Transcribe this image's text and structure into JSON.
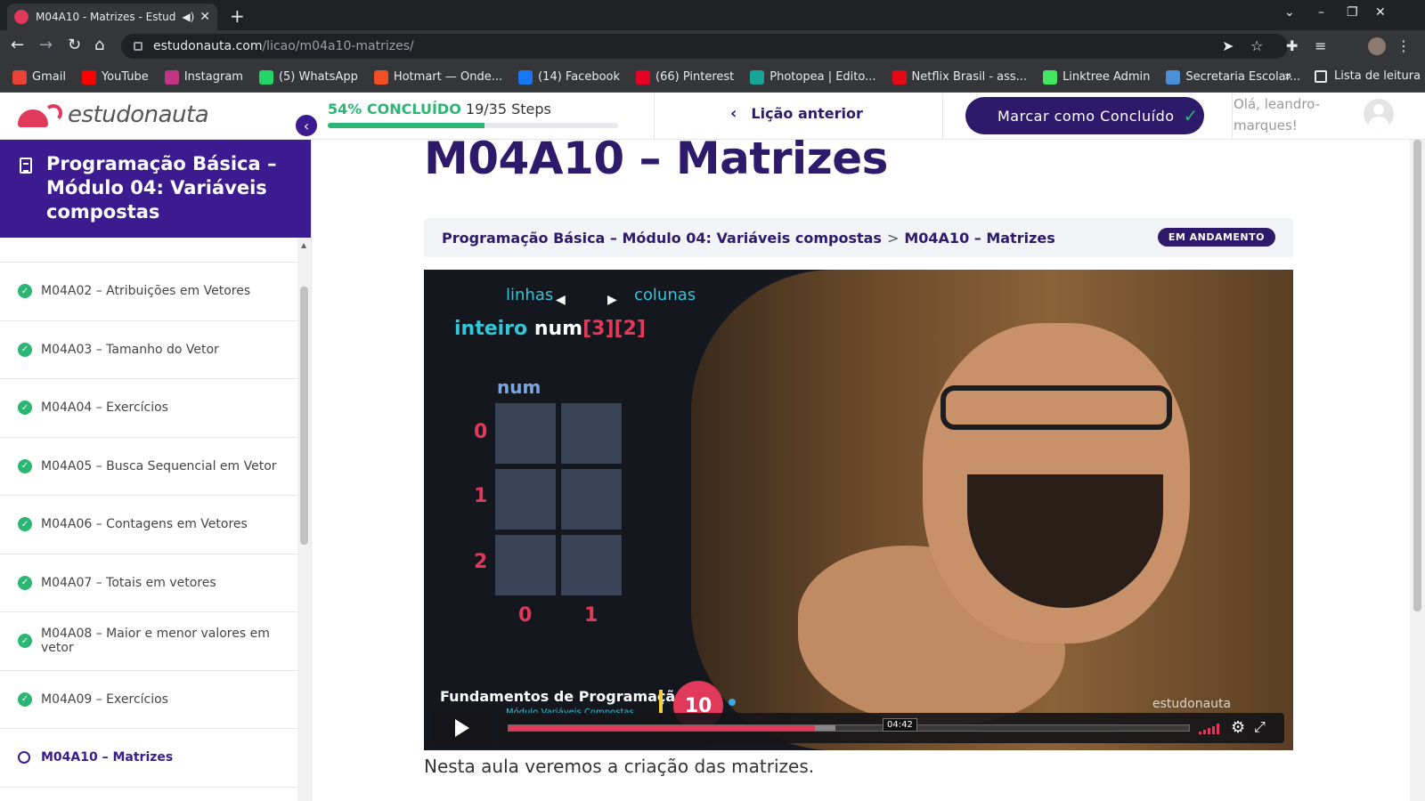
{
  "browser": {
    "tab_title": "M04A10 - Matrizes - Estud",
    "url_host": "estudonauta.com",
    "url_path": "/licao/m04a10-matrizes/",
    "bookmarks": [
      {
        "label": "Gmail",
        "color": "#ea4335",
        "icon": "gmail-icon"
      },
      {
        "label": "YouTube",
        "color": "#ff0000",
        "icon": "youtube-icon"
      },
      {
        "label": "Instagram",
        "color": "#c13584",
        "icon": "instagram-icon"
      },
      {
        "label": "(5) WhatsApp",
        "color": "#25d366",
        "icon": "whatsapp-icon"
      },
      {
        "label": "Hotmart — Onde...",
        "color": "#f04e23",
        "icon": "hotmart-icon"
      },
      {
        "label": "(14) Facebook",
        "color": "#1877f2",
        "icon": "facebook-icon"
      },
      {
        "label": "(66) Pinterest",
        "color": "#e60023",
        "icon": "pinterest-icon"
      },
      {
        "label": "Photopea | Edito...",
        "color": "#18a497",
        "icon": "photopea-icon"
      },
      {
        "label": "Netflix Brasil - ass...",
        "color": "#e50914",
        "icon": "netflix-icon"
      },
      {
        "label": "Linktree Admin",
        "color": "#43e660",
        "icon": "linktree-icon"
      },
      {
        "label": "Secretaria Escolar...",
        "color": "#4a90d9",
        "icon": "secretaria-icon"
      }
    ],
    "more_bookmarks": "»",
    "reading_list": "Lista de leitura"
  },
  "header": {
    "logo_text": "estudonauta",
    "progress_pct_label": "54% CONCLUÍDO",
    "progress_steps": "19/35 Steps",
    "progress_fraction": 0.54,
    "prev_lesson": "Lição anterior",
    "mark_complete": "Marcar como Concluído",
    "greeting": "Olá, leandro-marques!"
  },
  "sidebar": {
    "course_title": "Programação Básica – Módulo 04: Variáveis compostas",
    "lessons": [
      {
        "label": "M04A02 – Atribuições em Vetores",
        "done": true
      },
      {
        "label": "M04A03 – Tamanho do Vetor",
        "done": true
      },
      {
        "label": "M04A04 – Exercícios",
        "done": true
      },
      {
        "label": "M04A05 – Busca Sequencial em Vetor",
        "done": true
      },
      {
        "label": "M04A06 – Contagens em Vetores",
        "done": true
      },
      {
        "label": "M04A07 – Totais em vetores",
        "done": true
      },
      {
        "label": "M04A08 – Maior e menor valores em vetor",
        "done": true
      },
      {
        "label": "M04A09 – Exercícios",
        "done": true
      },
      {
        "label": "M04A10 – Matrizes",
        "done": false
      }
    ]
  },
  "main": {
    "title": "M04A10 – Matrizes",
    "breadcrumb": {
      "course": "Programação Básica – Módulo 04: Variáveis compostas",
      "separator": ">",
      "lesson": "M04A10 – Matrizes"
    },
    "status_badge": "EM ANDAMENTO",
    "description": "Nesta aula veremos a criação das matrizes."
  },
  "video": {
    "label_rows": "linhas",
    "label_cols": "colunas",
    "code_kw": "inteiro",
    "code_var": "num",
    "code_idx": "[3][2]",
    "grid_label": "num",
    "row_labels": [
      "0",
      "1",
      "2"
    ],
    "col_labels": [
      "0",
      "1"
    ],
    "footer_title": "Fundamentos de Programação",
    "footer_sub": "Módulo Variáveis Compostas",
    "episode": "10",
    "watermark": "estudonauta",
    "tooltip_time": "04:42",
    "played_fraction": 0.45,
    "buffered_fraction": 0.48
  }
}
